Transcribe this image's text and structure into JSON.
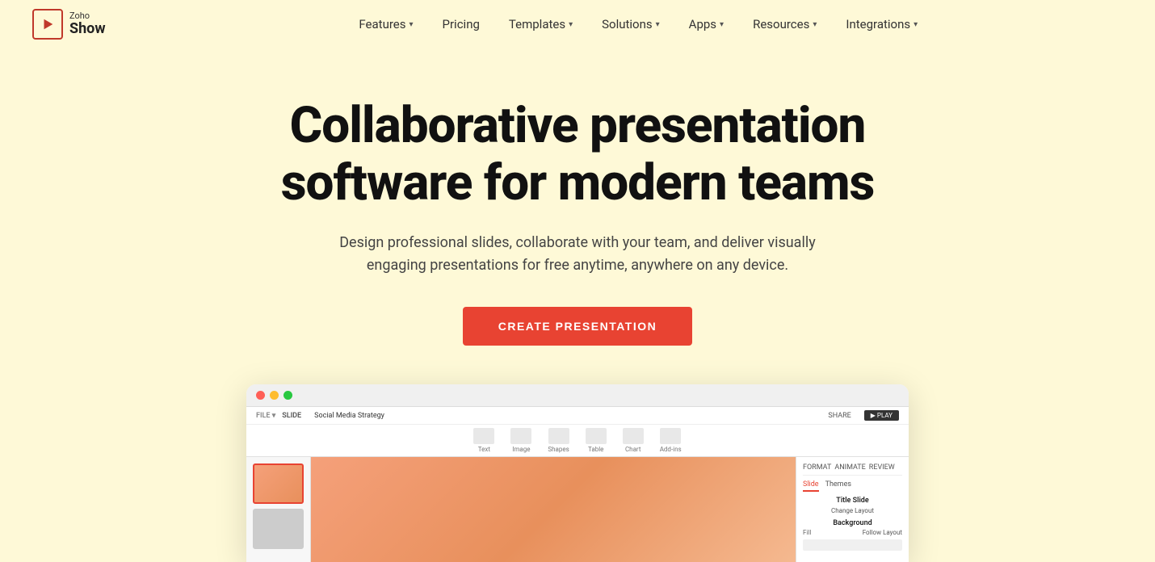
{
  "logo": {
    "zoho_text": "Zoho",
    "show_text": "Show"
  },
  "nav": {
    "items": [
      {
        "label": "Features",
        "has_dropdown": true
      },
      {
        "label": "Pricing",
        "has_dropdown": false
      },
      {
        "label": "Templates",
        "has_dropdown": true
      },
      {
        "label": "Solutions",
        "has_dropdown": true
      },
      {
        "label": "Apps",
        "has_dropdown": true
      },
      {
        "label": "Resources",
        "has_dropdown": true
      },
      {
        "label": "Integrations",
        "has_dropdown": true
      }
    ]
  },
  "hero": {
    "title": "Collaborative presentation software for modern teams",
    "subtitle": "Design professional slides, collaborate with your team, and deliver visually engaging presentations for free anytime, anywhere on any device.",
    "cta_label": "CREATE PRESENTATION"
  },
  "app_ui": {
    "toolbar_items": [
      {
        "label": "Text"
      },
      {
        "label": "Image"
      },
      {
        "label": "Shapes"
      },
      {
        "label": "Table"
      },
      {
        "label": "Chart"
      },
      {
        "label": "Add-ins"
      }
    ],
    "filename": "Social Media Strategy",
    "share_label": "SHARE",
    "play_label": "▶ PLAY",
    "right_panel": {
      "tabs": [
        "Slide",
        "Themes"
      ],
      "section_title": "Title Slide",
      "subsection": "Change Layout",
      "background_label": "Background",
      "fill_label": "Fill",
      "fill_value": "Follow Layout"
    }
  }
}
